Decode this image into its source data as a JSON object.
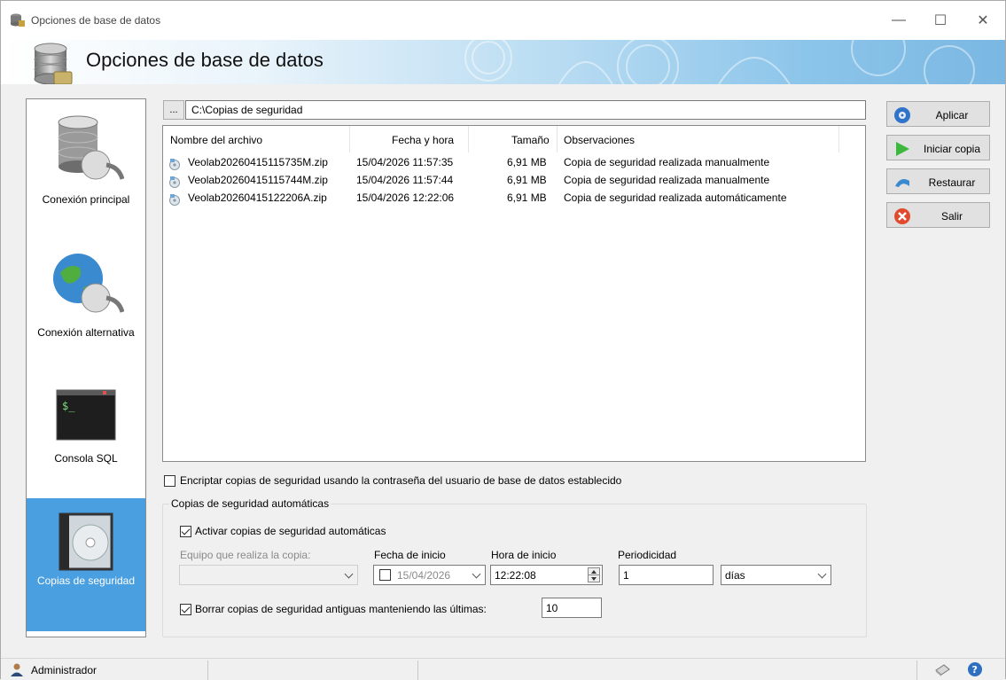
{
  "window": {
    "title": "Opciones de base de datos",
    "controls": {
      "minimize": "—",
      "maximize": "☐",
      "close": "✕"
    }
  },
  "header": {
    "title": "Opciones de base de datos"
  },
  "sidebar": {
    "items": [
      {
        "label": "Conexión principal",
        "icon": "database-plug-icon",
        "active": false
      },
      {
        "label": "Conexión alternativa",
        "icon": "globe-plug-icon",
        "active": false
      },
      {
        "label": "Consola SQL",
        "icon": "terminal-icon",
        "active": false
      },
      {
        "label": "Copias de seguridad",
        "icon": "disc-case-icon",
        "active": true
      }
    ]
  },
  "backup": {
    "browse_label": "...",
    "path": "C:\\Copias de seguridad",
    "columns": [
      "Nombre del archivo",
      "Fecha y hora",
      "Tamaño",
      "Observaciones"
    ],
    "files": [
      {
        "name": "Veolab20260415115735M.zip",
        "datetime": "15/04/2026 11:57:35",
        "size": "6,91 MB",
        "notes": "Copia de seguridad realizada manualmente"
      },
      {
        "name": "Veolab20260415115744M.zip",
        "datetime": "15/04/2026 11:57:44",
        "size": "6,91 MB",
        "notes": "Copia de seguridad realizada manualmente"
      },
      {
        "name": "Veolab20260415122206A.zip",
        "datetime": "15/04/2026 12:22:06",
        "size": "6,91 MB",
        "notes": "Copia de seguridad realizada automáticamente"
      }
    ],
    "encrypt_label": "Encriptar copias de seguridad usando la contraseña del usuario de base de datos establecido",
    "encrypt_checked": false
  },
  "auto": {
    "group_title": "Copias de seguridad automáticas",
    "enable_label": "Activar copias de seguridad automáticas",
    "enable_checked": true,
    "machine_label": "Equipo que realiza la copia:",
    "machine_value": "",
    "start_date_label": "Fecha de inicio",
    "start_date_value": "15/04/2026",
    "start_date_checked": false,
    "start_time_label": "Hora de inicio",
    "start_time_value": "12:22:08",
    "period_label": "Periodicidad",
    "period_value": "1",
    "period_unit": "días",
    "delete_label": "Borrar copias de seguridad antiguas manteniendo las últimas:",
    "delete_checked": true,
    "keep_count": "10"
  },
  "actions": {
    "apply": "Aplicar",
    "start_backup": "Iniciar copia",
    "restore": "Restaurar",
    "exit": "Salir"
  },
  "status": {
    "user": "Administrador"
  },
  "colors": {
    "accent": "#4a9fe0",
    "play": "#3cb83c",
    "exit": "#e24a2f"
  }
}
